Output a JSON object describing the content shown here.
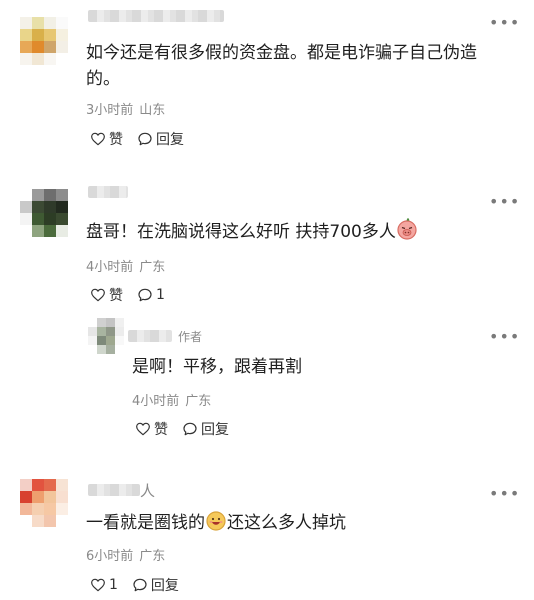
{
  "comments": [
    {
      "text": "如今还是有很多假的资金盘。都是电诈骗子自己伪造的。",
      "time": "3小时前",
      "location": "山东",
      "like_label": "赞",
      "reply_label": "回复"
    },
    {
      "text": "盘哥！在洗脑说得这么好听 扶持700多人",
      "time": "4小时前",
      "location": "广东",
      "like_label": "赞",
      "reply_count": "1",
      "reply": {
        "author_tag": "作者",
        "text": "是啊！平移，跟着再割",
        "time": "4小时前",
        "location": "广东",
        "like_label": "赞",
        "reply_label": "回复"
      }
    },
    {
      "name_suffix": "人",
      "text_before": "一看就是圈钱的",
      "text_after": "还这么多人掉坑",
      "time": "6小时前",
      "location": "广东",
      "like_count": "1",
      "reply_label": "回复"
    }
  ],
  "icons": {
    "more": "more-horizontal-icon",
    "like": "heart-outline-icon",
    "reply": "speech-bubble-icon",
    "emoji_pig": "pig-face-emoji",
    "emoji_grin": "grinning-emoji"
  },
  "colors": {
    "meta": "#8a8a8a",
    "text": "#1f1f1f",
    "icon": "#333333"
  }
}
